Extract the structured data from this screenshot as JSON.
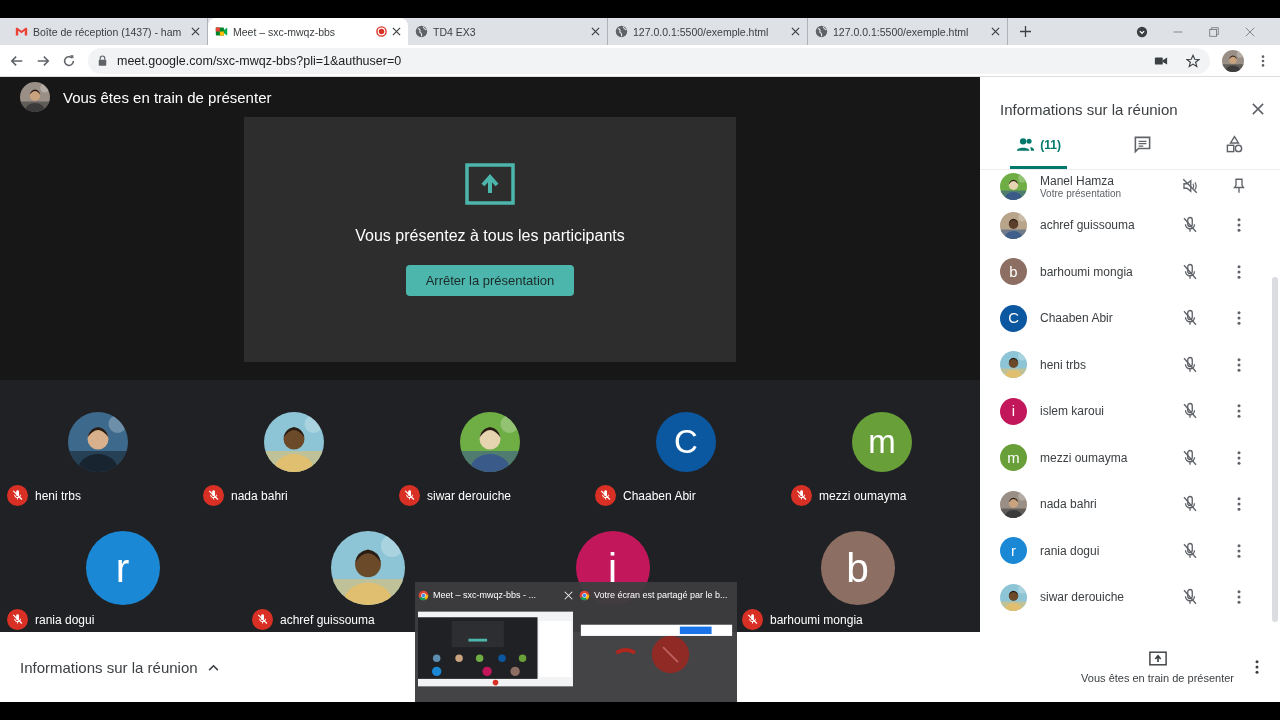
{
  "browser": {
    "tabs": [
      {
        "title": "Boîte de réception (1437) - ham",
        "kind": "mail",
        "selected": false,
        "recording": false
      },
      {
        "title": "Meet – sxc-mwqz-bbs",
        "kind": "meet",
        "selected": true,
        "recording": true
      },
      {
        "title": "TD4 EX3",
        "kind": "web",
        "selected": false,
        "recording": false
      },
      {
        "title": "127.0.0.1:5500/exemple.html",
        "kind": "web",
        "selected": false,
        "recording": false
      },
      {
        "title": "127.0.0.1:5500/exemple.html",
        "kind": "web",
        "selected": false,
        "recording": false
      }
    ],
    "url": "meet.google.com/sxc-mwqz-bbs?pli=1&authuser=0"
  },
  "presenter_bar": {
    "text": "Vous êtes en train de présenter"
  },
  "presentation_card": {
    "message": "Vous présentez à tous les participants",
    "button": "Arrêter la présentation"
  },
  "tile_rows": [
    [
      {
        "name": "heni trbs",
        "muted": true
      },
      {
        "name": "nada bahri",
        "muted": true
      },
      {
        "name": "siwar derouiche",
        "muted": true
      },
      {
        "name": "Chaaben Abir",
        "muted": true,
        "avatar": {
          "kind": "letter",
          "letter": "C",
          "color": "#0b57a0"
        }
      },
      {
        "name": "mezzi oumayma",
        "muted": true,
        "avatar": {
          "kind": "letter",
          "letter": "m",
          "color": "#689f38"
        }
      }
    ],
    [
      {
        "name": "rania dogui",
        "muted": true,
        "avatar": {
          "kind": "letter",
          "letter": "r",
          "color": "#1a88d4"
        }
      },
      {
        "name": "achref guissouma",
        "muted": true
      },
      {
        "avatar": {
          "kind": "letter",
          "letter": "i",
          "color": "#c2185b"
        }
      },
      {
        "name": "barhoumi mongia",
        "muted": true,
        "avatar": {
          "kind": "letter",
          "letter": "b",
          "color": "#8d6e63"
        }
      }
    ]
  ],
  "panel": {
    "title": "Informations sur la réunion",
    "tabs": [
      {
        "kind": "people",
        "label": "(11)",
        "selected": true
      },
      {
        "kind": "chat",
        "selected": false
      },
      {
        "kind": "activities",
        "selected": false
      }
    ],
    "participants": [
      {
        "kind": "self",
        "name": "Manel Hamza",
        "subtitle": "Votre présentation"
      },
      {
        "kind": "other",
        "name": "achref guissouma",
        "muted": true
      },
      {
        "kind": "other",
        "name": "barhoumi mongia",
        "muted": true,
        "avatar": {
          "kind": "letter",
          "letter": "b",
          "color": "#8d6e63"
        }
      },
      {
        "kind": "other",
        "name": "Chaaben Abir",
        "muted": true,
        "avatar": {
          "kind": "letter",
          "letter": "C",
          "color": "#0b57a0"
        }
      },
      {
        "kind": "other",
        "name": "heni trbs",
        "muted": true
      },
      {
        "kind": "other",
        "name": "islem karoui",
        "muted": true,
        "avatar": {
          "kind": "letter",
          "letter": "i",
          "color": "#c2185b"
        }
      },
      {
        "kind": "other",
        "name": "mezzi oumayma",
        "muted": true,
        "avatar": {
          "kind": "letter",
          "letter": "m",
          "color": "#689f38"
        }
      },
      {
        "kind": "other",
        "name": "nada bahri",
        "muted": true
      },
      {
        "kind": "other",
        "name": "rania dogui",
        "muted": true,
        "avatar": {
          "kind": "letter",
          "letter": "r",
          "color": "#1a88d4"
        }
      },
      {
        "kind": "other",
        "name": "siwar derouiche",
        "muted": true
      }
    ]
  },
  "bottom_bar": {
    "meeting_details": "Informations sur la réunion",
    "presenting_label": "Vous êtes en train de présenter"
  },
  "taskbar_preview": {
    "windows": [
      {
        "title": "Meet – sxc-mwqz-bbs - ...",
        "closable": true,
        "kind": "meet"
      },
      {
        "title": "Votre écran est partagé par le b...",
        "closable": false,
        "kind": "banner"
      }
    ]
  }
}
